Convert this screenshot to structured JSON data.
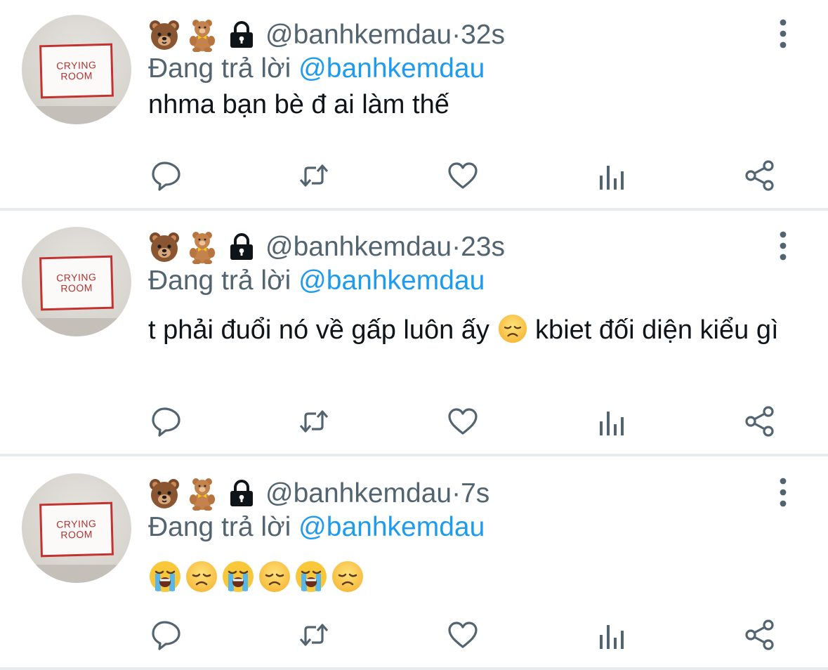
{
  "tweets": [
    {
      "handle": "@banhkemdau",
      "time": "32s",
      "reply_prefix": "Đang trả lời ",
      "reply_mention": "@banhkemdau",
      "text": "nhma bạn bè đ ai làm thế",
      "avatar_sign": [
        "CRYING",
        "ROOM"
      ]
    },
    {
      "handle": "@banhkemdau",
      "time": "23s",
      "reply_prefix": "Đang trả lời ",
      "reply_mention": "@banhkemdau",
      "text_before_emoji": "t phải đuổi nó về gấp luôn ấy ",
      "inline_emoji": "disappointed-face",
      "text_after_emoji": " kbiet đối diện kiểu gì",
      "avatar_sign": [
        "CRYING",
        "ROOM"
      ]
    },
    {
      "handle": "@banhkemdau",
      "time": "7s",
      "reply_prefix": "Đang trả lời ",
      "reply_mention": "@banhkemdau",
      "emojis": [
        "loudly-crying-face",
        "disappointed-face",
        "loudly-crying-face",
        "disappointed-face",
        "loudly-crying-face",
        "disappointed-face"
      ],
      "avatar_sign": [
        "CRYING",
        "ROOM"
      ]
    }
  ],
  "name_badges": [
    "bear-face-emoji",
    "teddy-bear-emoji",
    "lock-icon"
  ],
  "handle_time_separator": " · ",
  "action_icons": [
    "reply-icon",
    "retweet-icon",
    "like-icon",
    "analytics-icon",
    "share-icon"
  ],
  "colors": {
    "text_primary": "#0f1419",
    "text_secondary": "#536471",
    "mention": "#1d9bf0",
    "icon": "#536471",
    "divider": "#e9ecee"
  }
}
